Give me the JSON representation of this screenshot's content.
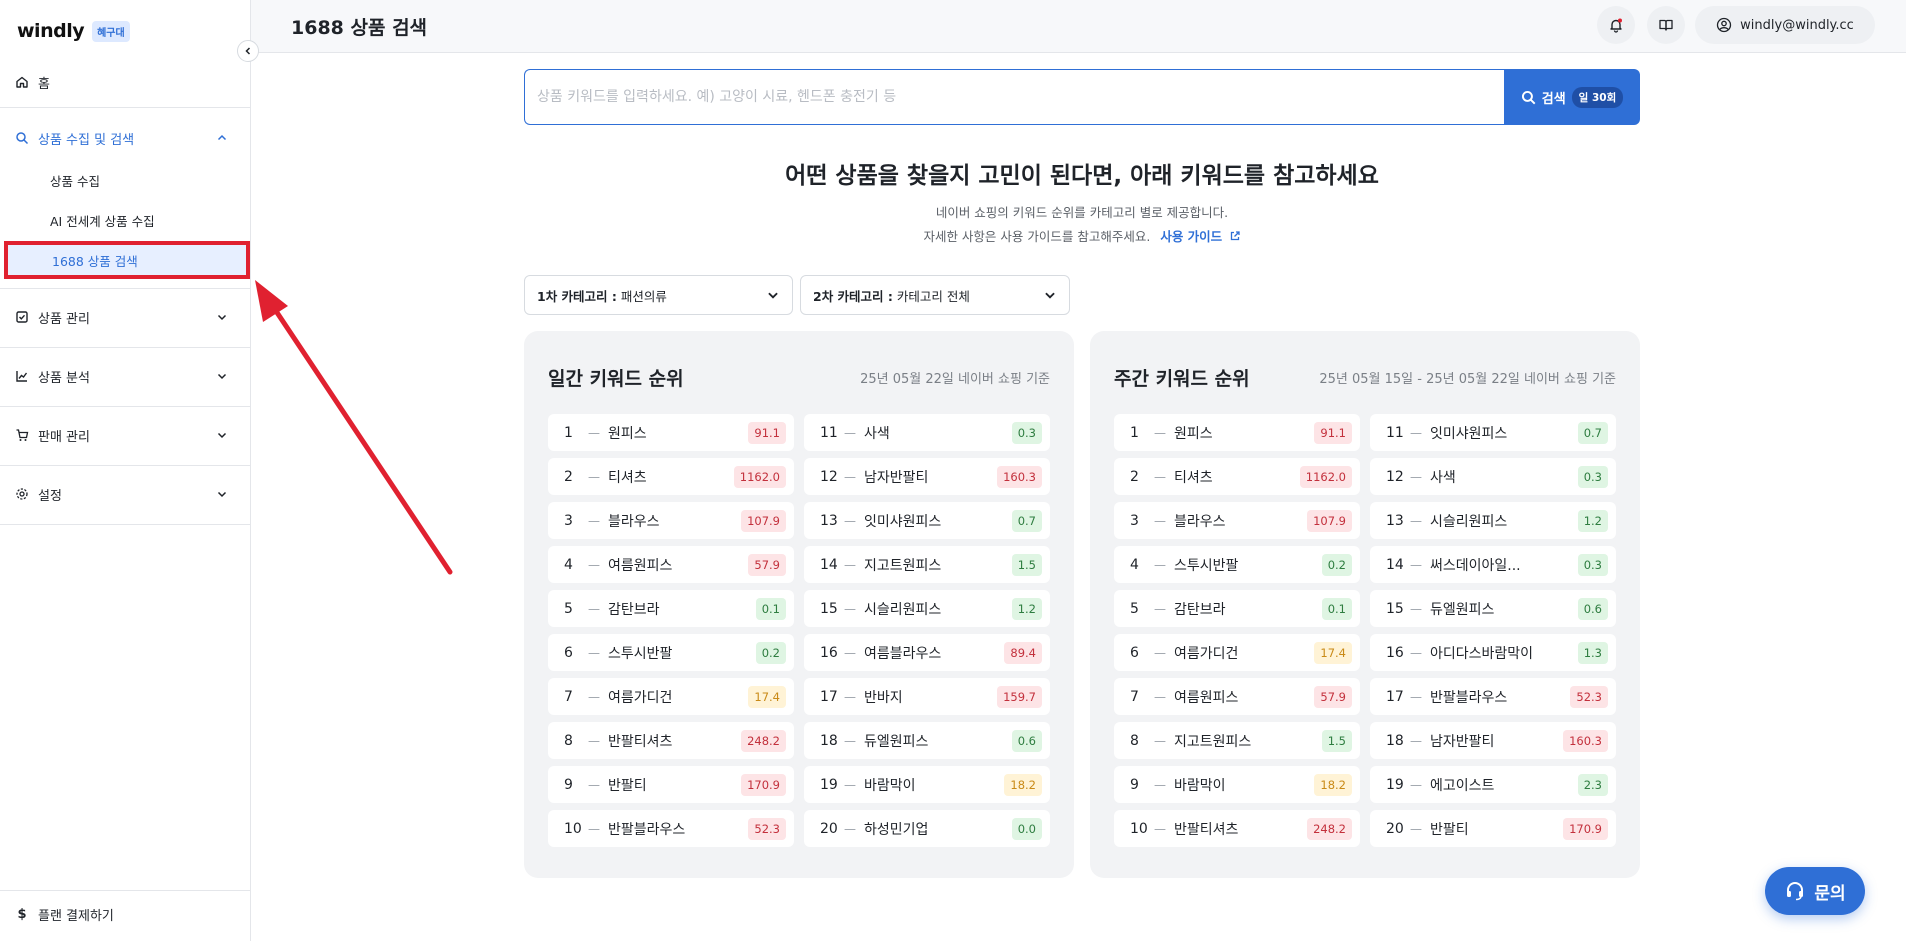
{
  "brand": {
    "logo": "windly",
    "badge": "혜구대"
  },
  "sidebar": {
    "home": "홈",
    "group_collect": "상품 수집 및 검색",
    "sub_items": [
      "상품 수집",
      "AI 전세계 상품 수집",
      "1688 상품 검색"
    ],
    "product_manage": "상품 관리",
    "product_analysis": "상품 분석",
    "sales_manage": "판매 관리",
    "settings": "설정",
    "plan_payment": "플랜 결제하기"
  },
  "header": {
    "title": "1688 상품 검색",
    "user_email": "windly@windly.cc"
  },
  "search": {
    "placeholder": "상품 키워드를 입력하세요. 예) 고양이 시료, 헨드폰 충전기 등",
    "button_label": "검색",
    "quota": "일 30회"
  },
  "hero": {
    "title": "어떤 상품을 찾을지 고민이 된다면, 아래 키워드를 참고하세요",
    "line1": "네이버 쇼핑의 키워드 순위를 카테고리 별로 제공합니다.",
    "line2": "자세한 사항은 사용 가이드를 참고해주세요.",
    "guide_link": "사용 가이드"
  },
  "filters": {
    "cat1_label": "1차 카테고리 :",
    "cat1_value": "패션의류",
    "cat2_label": "2차 카테고리 :",
    "cat2_value": "카테고리 전체"
  },
  "daily": {
    "title": "일간 키워드 순위",
    "date": "25년 05월 22일 네이버 쇼핑 기준",
    "items": [
      {
        "rank": "1",
        "name": "원피스",
        "value": "91.1",
        "tone": "red"
      },
      {
        "rank": "2",
        "name": "티셔츠",
        "value": "1162.0",
        "tone": "red"
      },
      {
        "rank": "3",
        "name": "블라우스",
        "value": "107.9",
        "tone": "red"
      },
      {
        "rank": "4",
        "name": "여름원피스",
        "value": "57.9",
        "tone": "red"
      },
      {
        "rank": "5",
        "name": "감탄브라",
        "value": "0.1",
        "tone": "green"
      },
      {
        "rank": "6",
        "name": "스투시반팔",
        "value": "0.2",
        "tone": "green"
      },
      {
        "rank": "7",
        "name": "여름가디건",
        "value": "17.4",
        "tone": "yellow"
      },
      {
        "rank": "8",
        "name": "반팔티셔츠",
        "value": "248.2",
        "tone": "red"
      },
      {
        "rank": "9",
        "name": "반팔티",
        "value": "170.9",
        "tone": "red"
      },
      {
        "rank": "10",
        "name": "반팔블라우스",
        "value": "52.3",
        "tone": "red"
      },
      {
        "rank": "11",
        "name": "사색",
        "value": "0.3",
        "tone": "green"
      },
      {
        "rank": "12",
        "name": "남자반팔티",
        "value": "160.3",
        "tone": "red"
      },
      {
        "rank": "13",
        "name": "잇미샤원피스",
        "value": "0.7",
        "tone": "green"
      },
      {
        "rank": "14",
        "name": "지고트원피스",
        "value": "1.5",
        "tone": "green"
      },
      {
        "rank": "15",
        "name": "시슬리원피스",
        "value": "1.2",
        "tone": "green"
      },
      {
        "rank": "16",
        "name": "여름블라우스",
        "value": "89.4",
        "tone": "red"
      },
      {
        "rank": "17",
        "name": "반바지",
        "value": "159.7",
        "tone": "red"
      },
      {
        "rank": "18",
        "name": "듀엘원피스",
        "value": "0.6",
        "tone": "green"
      },
      {
        "rank": "19",
        "name": "바람막이",
        "value": "18.2",
        "tone": "yellow"
      },
      {
        "rank": "20",
        "name": "하성민기업",
        "value": "0.0",
        "tone": "green"
      }
    ]
  },
  "weekly": {
    "title": "주간 키워드 순위",
    "date": "25년 05월 15일 - 25년 05월 22일 네이버 쇼핑 기준",
    "items": [
      {
        "rank": "1",
        "name": "원피스",
        "value": "91.1",
        "tone": "red"
      },
      {
        "rank": "2",
        "name": "티셔츠",
        "value": "1162.0",
        "tone": "red"
      },
      {
        "rank": "3",
        "name": "블라우스",
        "value": "107.9",
        "tone": "red"
      },
      {
        "rank": "4",
        "name": "스투시반팔",
        "value": "0.2",
        "tone": "green"
      },
      {
        "rank": "5",
        "name": "감탄브라",
        "value": "0.1",
        "tone": "green"
      },
      {
        "rank": "6",
        "name": "여름가디건",
        "value": "17.4",
        "tone": "yellow"
      },
      {
        "rank": "7",
        "name": "여름원피스",
        "value": "57.9",
        "tone": "red"
      },
      {
        "rank": "8",
        "name": "지고트원피스",
        "value": "1.5",
        "tone": "green"
      },
      {
        "rank": "9",
        "name": "바람막이",
        "value": "18.2",
        "tone": "yellow"
      },
      {
        "rank": "10",
        "name": "반팔티셔츠",
        "value": "248.2",
        "tone": "red"
      },
      {
        "rank": "11",
        "name": "잇미샤원피스",
        "value": "0.7",
        "tone": "green"
      },
      {
        "rank": "12",
        "name": "사색",
        "value": "0.3",
        "tone": "green"
      },
      {
        "rank": "13",
        "name": "시슬리원피스",
        "value": "1.2",
        "tone": "green"
      },
      {
        "rank": "14",
        "name": "써스데이아일...",
        "value": "0.3",
        "tone": "green"
      },
      {
        "rank": "15",
        "name": "듀엘원피스",
        "value": "0.6",
        "tone": "green"
      },
      {
        "rank": "16",
        "name": "아디다스바람막이",
        "value": "1.3",
        "tone": "green"
      },
      {
        "rank": "17",
        "name": "반팔블라우스",
        "value": "52.3",
        "tone": "red"
      },
      {
        "rank": "18",
        "name": "남자반팔티",
        "value": "160.3",
        "tone": "red"
      },
      {
        "rank": "19",
        "name": "에고이스트",
        "value": "2.3",
        "tone": "green"
      },
      {
        "rank": "20",
        "name": "반팔티",
        "value": "170.9",
        "tone": "red"
      }
    ]
  },
  "inquiry_label": "문의",
  "colors": {
    "accent": "#2f6fd6",
    "highlight_box": "#e02130"
  },
  "icons": [
    "home-icon",
    "search-icon",
    "chevron-up-icon",
    "checkbox-icon",
    "chart-icon",
    "cart-icon",
    "gear-icon",
    "dollar-icon",
    "bell-icon",
    "book-icon",
    "user-icon",
    "external-link-icon",
    "headset-icon"
  ]
}
